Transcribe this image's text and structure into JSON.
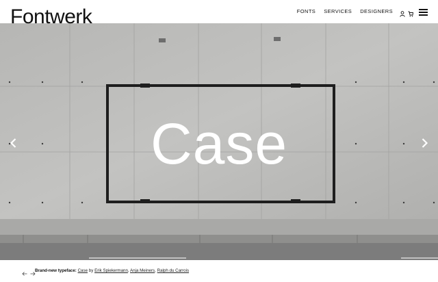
{
  "brand": {
    "logo_text": "Fontwerk"
  },
  "nav": {
    "items": [
      {
        "label": "FONTS"
      },
      {
        "label": "SERVICES"
      },
      {
        "label": "DESIGNERS"
      }
    ],
    "icons": [
      "user-icon",
      "cart-icon",
      "hamburger-menu-icon"
    ]
  },
  "hero": {
    "title": "Case",
    "prev_icon": "chevron-left-icon",
    "next_icon": "chevron-right-icon"
  },
  "caption": {
    "lead": "Brand-new typeface:",
    "typeface": "Case",
    "by": "by",
    "designers": [
      "Erik Spiekermann",
      "Anja Meiners",
      "Ralph du Carrois"
    ],
    "comma": ",",
    "prev_icon": "arrow-left-icon",
    "next_icon": "arrow-right-icon"
  },
  "colors": {
    "concrete": "#b9b9b7",
    "frame": "#1e1e1e",
    "text": "#111111"
  }
}
